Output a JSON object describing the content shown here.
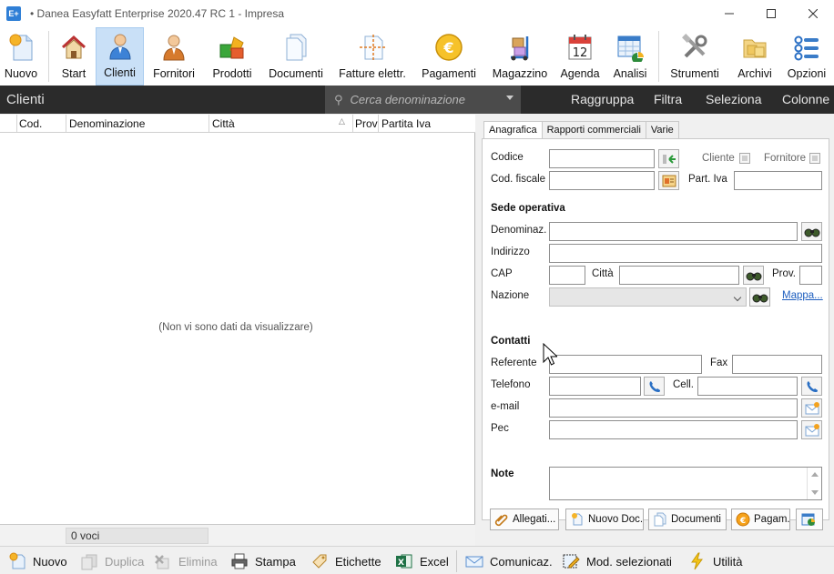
{
  "window": {
    "app_icon": "E+",
    "title": "•  Danea Easyfatt Enterprise  2020.47 RC 1  -  Impresa",
    "minimize_icon": "minimize-icon",
    "maximize_icon": "maximize-icon",
    "close_icon": "close-icon"
  },
  "ribbon": {
    "items": [
      {
        "label": "Nuovo",
        "icon": "new-document-icon"
      },
      {
        "label": "Start",
        "icon": "home-icon"
      },
      {
        "label": "Clienti",
        "icon": "client-user-icon",
        "active": true
      },
      {
        "label": "Fornitori",
        "icon": "supplier-user-icon"
      },
      {
        "label": "Prodotti",
        "icon": "products-boxes-icon"
      },
      {
        "label": "Documenti",
        "icon": "documents-icon"
      },
      {
        "label": "Fatture elettr.",
        "icon": "e-invoice-icon"
      },
      {
        "label": "Pagamenti",
        "icon": "euro-coin-icon"
      },
      {
        "label": "Magazzino",
        "icon": "warehouse-trolley-icon"
      },
      {
        "label": "Agenda",
        "icon": "calendar-icon",
        "calendar_day": "12"
      },
      {
        "label": "Analisi",
        "icon": "analysis-chart-icon"
      },
      {
        "label": "Strumenti",
        "icon": "tools-icon"
      },
      {
        "label": "Archivi",
        "icon": "archives-folder-icon"
      },
      {
        "label": "Opzioni",
        "icon": "options-icon"
      }
    ]
  },
  "darkbar": {
    "title": "Clienti",
    "search_placeholder": "Cerca denominazione",
    "links": [
      "Raggruppa",
      "Filtra",
      "Seleziona",
      "Colonne"
    ]
  },
  "grid": {
    "columns": [
      "Cod.",
      "Denominazione",
      "Città",
      "Prov",
      "Partita Iva"
    ],
    "sorted_column": "Città",
    "empty_message": "(Non vi sono dati da visualizzare)",
    "footer_count": "0 voci"
  },
  "panel": {
    "tabs": [
      "Anagrafica",
      "Rapporti commerciali",
      "Varie"
    ],
    "active_tab": "Anagrafica",
    "labels": {
      "codice": "Codice",
      "cliente": "Cliente",
      "fornitore": "Fornitore",
      "cod_fiscale": "Cod. fiscale",
      "part_iva": "Part. Iva",
      "sede_operativa": "Sede operativa",
      "denominaz": "Denominaz.",
      "indirizzo": "Indirizzo",
      "cap": "CAP",
      "citta": "Città",
      "prov": "Prov.",
      "nazione": "Nazione",
      "mappa": "Mappa...",
      "contatti": "Contatti",
      "referente": "Referente",
      "fax": "Fax",
      "telefono": "Telefono",
      "cell": "Cell.",
      "email": "e-mail",
      "pec": "Pec",
      "note": "Note"
    },
    "fields": {
      "codice": "",
      "cod_fiscale": "",
      "part_iva": "",
      "denominaz": "",
      "indirizzo": "",
      "cap": "",
      "citta": "",
      "prov": "",
      "nazione": "",
      "referente": "",
      "fax": "",
      "telefono": "",
      "cell": "",
      "email": "",
      "pec": "",
      "note": ""
    },
    "checkboxes": {
      "cliente": false,
      "fornitore": false
    },
    "buttons": [
      "Allegati...",
      "Nuovo Doc.",
      "Documenti",
      "Pagam."
    ]
  },
  "bottombar": {
    "items": [
      {
        "label": "Nuovo",
        "icon": "new-icon",
        "enabled": true
      },
      {
        "label": "Duplica",
        "icon": "duplicate-icon",
        "enabled": false
      },
      {
        "label": "Elimina",
        "icon": "delete-icon",
        "enabled": false
      },
      {
        "label": "Stampa",
        "icon": "printer-icon",
        "enabled": true
      },
      {
        "label": "Etichette",
        "icon": "label-tag-icon",
        "enabled": true
      },
      {
        "label": "Excel",
        "icon": "excel-icon",
        "enabled": true
      },
      {
        "label": "Comunicaz.",
        "icon": "envelope-icon",
        "enabled": true
      },
      {
        "label": "Mod. selezionati",
        "icon": "edit-selected-icon",
        "enabled": true
      },
      {
        "label": "Utilità",
        "icon": "lightning-icon",
        "enabled": true
      }
    ]
  },
  "colors": {
    "accent": "#2f7fd6",
    "active_ribbon": "#c9e0f7",
    "dark_bar": "#2b2b2b",
    "search_box": "#4b4b4b",
    "link": "#1f5fbf"
  }
}
